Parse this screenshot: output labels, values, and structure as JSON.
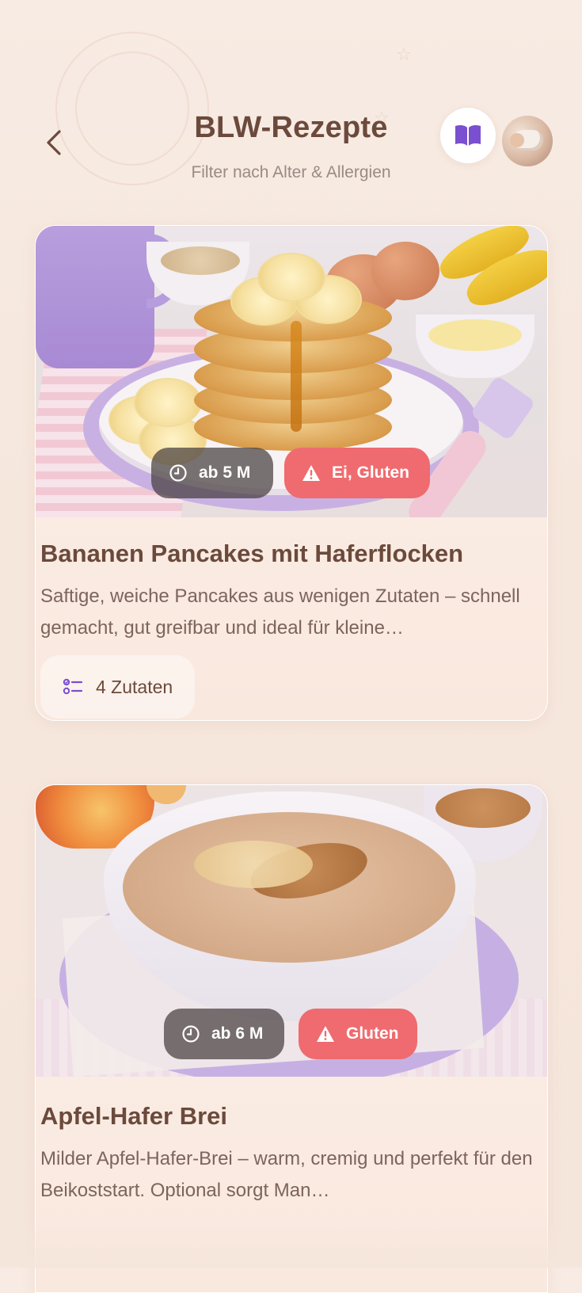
{
  "header": {
    "title": "BLW-Rezepte",
    "subtitle": "Filter nach Alter & Allergien",
    "back_icon": "chevron-left-icon",
    "book_icon": "book-open-icon"
  },
  "colors": {
    "accent_purple": "#7a4fd0",
    "allergen_red": "#ef6b6f",
    "text_brown": "#6b4a3c"
  },
  "recipes": [
    {
      "age": "ab 5 M",
      "allergens": "Ei, Gluten",
      "title": "Bananen Pancakes mit Haferflocken",
      "description": "Saftige, weiche Pancakes aus wenigen Zutaten – schnell gemacht, gut greifbar und ideal für kleine…",
      "ingredients": "4 Zutaten"
    },
    {
      "age": "ab 6 M",
      "allergens": "Gluten",
      "title": "Apfel-Hafer Brei",
      "description": "Milder Apfel-Hafer-Brei – warm, cremig und perfekt für den Beikoststart. Optional sorgt Man…"
    }
  ]
}
